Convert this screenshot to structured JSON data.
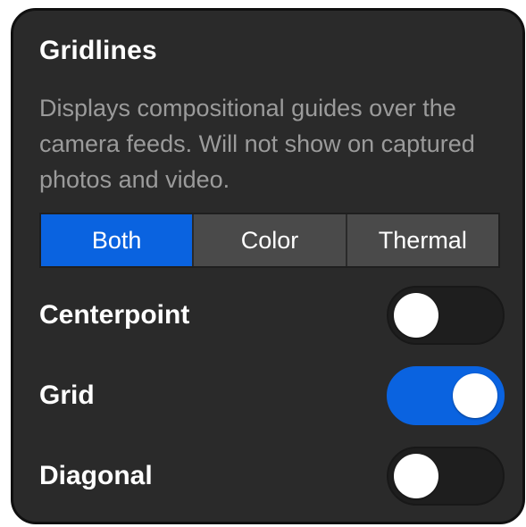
{
  "section": {
    "title": "Gridlines",
    "description": "Displays compositional guides over the camera feeds. Will not show on captured photos and video."
  },
  "segmented_control": {
    "options": [
      {
        "label": "Both",
        "selected": true
      },
      {
        "label": "Color",
        "selected": false
      },
      {
        "label": "Thermal",
        "selected": false
      }
    ]
  },
  "toggles": [
    {
      "label": "Centerpoint",
      "on": false
    },
    {
      "label": "Grid",
      "on": true
    },
    {
      "label": "Diagonal",
      "on": false
    }
  ],
  "colors": {
    "accent": "#0a63e0",
    "panel_bg": "#2a2a2a",
    "segment_bg": "#4a4a4a",
    "toggle_off_bg": "#1e1e1e",
    "description_text": "#9b9b9b"
  }
}
